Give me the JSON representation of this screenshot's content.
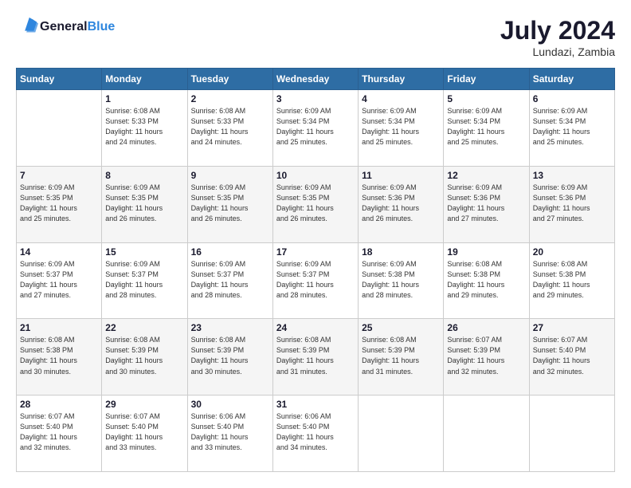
{
  "logo": {
    "text_general": "General",
    "text_blue": "Blue"
  },
  "header": {
    "month": "July 2024",
    "location": "Lundazi, Zambia"
  },
  "days_of_week": [
    "Sunday",
    "Monday",
    "Tuesday",
    "Wednesday",
    "Thursday",
    "Friday",
    "Saturday"
  ],
  "weeks": [
    [
      {
        "day": "",
        "info": ""
      },
      {
        "day": "1",
        "info": "Sunrise: 6:08 AM\nSunset: 5:33 PM\nDaylight: 11 hours\nand 24 minutes."
      },
      {
        "day": "2",
        "info": "Sunrise: 6:08 AM\nSunset: 5:33 PM\nDaylight: 11 hours\nand 24 minutes."
      },
      {
        "day": "3",
        "info": "Sunrise: 6:09 AM\nSunset: 5:34 PM\nDaylight: 11 hours\nand 25 minutes."
      },
      {
        "day": "4",
        "info": "Sunrise: 6:09 AM\nSunset: 5:34 PM\nDaylight: 11 hours\nand 25 minutes."
      },
      {
        "day": "5",
        "info": "Sunrise: 6:09 AM\nSunset: 5:34 PM\nDaylight: 11 hours\nand 25 minutes."
      },
      {
        "day": "6",
        "info": "Sunrise: 6:09 AM\nSunset: 5:34 PM\nDaylight: 11 hours\nand 25 minutes."
      }
    ],
    [
      {
        "day": "7",
        "info": ""
      },
      {
        "day": "8",
        "info": "Sunrise: 6:09 AM\nSunset: 5:35 PM\nDaylight: 11 hours\nand 26 minutes."
      },
      {
        "day": "9",
        "info": "Sunrise: 6:09 AM\nSunset: 5:35 PM\nDaylight: 11 hours\nand 26 minutes."
      },
      {
        "day": "10",
        "info": "Sunrise: 6:09 AM\nSunset: 5:35 PM\nDaylight: 11 hours\nand 26 minutes."
      },
      {
        "day": "11",
        "info": "Sunrise: 6:09 AM\nSunset: 5:36 PM\nDaylight: 11 hours\nand 26 minutes."
      },
      {
        "day": "12",
        "info": "Sunrise: 6:09 AM\nSunset: 5:36 PM\nDaylight: 11 hours\nand 27 minutes."
      },
      {
        "day": "13",
        "info": "Sunrise: 6:09 AM\nSunset: 5:36 PM\nDaylight: 11 hours\nand 27 minutes."
      }
    ],
    [
      {
        "day": "14",
        "info": ""
      },
      {
        "day": "15",
        "info": "Sunrise: 6:09 AM\nSunset: 5:37 PM\nDaylight: 11 hours\nand 28 minutes."
      },
      {
        "day": "16",
        "info": "Sunrise: 6:09 AM\nSunset: 5:37 PM\nDaylight: 11 hours\nand 28 minutes."
      },
      {
        "day": "17",
        "info": "Sunrise: 6:09 AM\nSunset: 5:37 PM\nDaylight: 11 hours\nand 28 minutes."
      },
      {
        "day": "18",
        "info": "Sunrise: 6:09 AM\nSunset: 5:38 PM\nDaylight: 11 hours\nand 28 minutes."
      },
      {
        "day": "19",
        "info": "Sunrise: 6:08 AM\nSunset: 5:38 PM\nDaylight: 11 hours\nand 29 minutes."
      },
      {
        "day": "20",
        "info": "Sunrise: 6:08 AM\nSunset: 5:38 PM\nDaylight: 11 hours\nand 29 minutes."
      }
    ],
    [
      {
        "day": "21",
        "info": ""
      },
      {
        "day": "22",
        "info": "Sunrise: 6:08 AM\nSunset: 5:39 PM\nDaylight: 11 hours\nand 30 minutes."
      },
      {
        "day": "23",
        "info": "Sunrise: 6:08 AM\nSunset: 5:39 PM\nDaylight: 11 hours\nand 30 minutes."
      },
      {
        "day": "24",
        "info": "Sunrise: 6:08 AM\nSunset: 5:39 PM\nDaylight: 11 hours\nand 31 minutes."
      },
      {
        "day": "25",
        "info": "Sunrise: 6:08 AM\nSunset: 5:39 PM\nDaylight: 11 hours\nand 31 minutes."
      },
      {
        "day": "26",
        "info": "Sunrise: 6:07 AM\nSunset: 5:39 PM\nDaylight: 11 hours\nand 32 minutes."
      },
      {
        "day": "27",
        "info": "Sunrise: 6:07 AM\nSunset: 5:40 PM\nDaylight: 11 hours\nand 32 minutes."
      }
    ],
    [
      {
        "day": "28",
        "info": "Sunrise: 6:07 AM\nSunset: 5:40 PM\nDaylight: 11 hours\nand 32 minutes."
      },
      {
        "day": "29",
        "info": "Sunrise: 6:07 AM\nSunset: 5:40 PM\nDaylight: 11 hours\nand 33 minutes."
      },
      {
        "day": "30",
        "info": "Sunrise: 6:06 AM\nSunset: 5:40 PM\nDaylight: 11 hours\nand 33 minutes."
      },
      {
        "day": "31",
        "info": "Sunrise: 6:06 AM\nSunset: 5:40 PM\nDaylight: 11 hours\nand 34 minutes."
      },
      {
        "day": "",
        "info": ""
      },
      {
        "day": "",
        "info": ""
      },
      {
        "day": "",
        "info": ""
      }
    ]
  ],
  "week7_day7_info": "Sunrise: 6:09 AM\nSunset: 5:35 PM\nDaylight: 11 hours\nand 25 minutes.",
  "week14_info": "Sunrise: 6:09 AM\nSunset: 5:37 PM\nDaylight: 11 hours\nand 27 minutes.",
  "week21_info": "Sunrise: 6:08 AM\nSunset: 5:38 PM\nDaylight: 11 hours\nand 30 minutes."
}
